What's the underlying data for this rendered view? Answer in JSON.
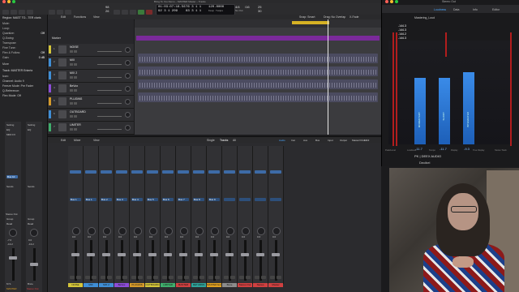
{
  "window": {
    "title": "Bring To You Demo – MASTER Master – Tracks"
  },
  "transport": {
    "position_time": "01:03:07:18.56",
    "position_bars": "92  3  1  209",
    "bars_alt": "76  3  1  1",
    "bars_alt2": "83  3  1  1",
    "tempo": "120.0000",
    "keep_tempo": "Keep Tempo",
    "sig": "4/4",
    "no_out": "No Out",
    "div": "/16",
    "extra_a": "98",
    "extra_b": "26",
    "extra_c": "25",
    "extra_d": "30"
  },
  "local_menu": {
    "edit": "Edit",
    "functions": "Functions",
    "view": "View",
    "snap": "Snap: Smart",
    "drag": "Drag: No Overlap",
    "fade": "X-Fade"
  },
  "inspector": {
    "region_label": "Region: MAST TO...TER claris",
    "rows": [
      {
        "label": "Mute:",
        "value": ""
      },
      {
        "label": "Loop:",
        "value": ""
      },
      {
        "label": "Quantize:",
        "value": "Off"
      },
      {
        "label": "Q-Swing:",
        "value": ""
      },
      {
        "label": "Transpose:",
        "value": ""
      },
      {
        "label": "Fine Tune:",
        "value": ""
      },
      {
        "label": "Flex & Follow:",
        "value": "Off"
      },
      {
        "label": "Gain:",
        "value": "0 dB"
      }
    ],
    "more_label": "More",
    "track_label": "Track: MASTER Entertz",
    "icon_label": "Icon:",
    "channel_label": "Channel: Audio 9",
    "freeze_label": "Freeze Mode: Pre Fader",
    "q_reference": "Q-Reference:",
    "flex_mode": "Flex Mode: Off",
    "setting": "Setting",
    "eq": "EQ",
    "midi_fx": "MIDI FX",
    "sends": "Sends",
    "bus_label": "Bus 10",
    "stereo_out": "Stereo Out",
    "group": "Group",
    "read": "Read",
    "left_vol": "-7.0",
    "right_vol": "0.0",
    "left_pan": "-13.2",
    "right_pan": "-13.2",
    "bnc": "Bnce",
    "mute_solo": "M  S",
    "left_name": "MASTER",
    "right_name": "Stereo Out"
  },
  "mixer_tab": {
    "mixer": "Mixer",
    "single": "Single",
    "tracks": "Tracks",
    "all": "All"
  },
  "mixer_filters": [
    "Audio",
    "Inst",
    "Aux",
    "Bus",
    "Input",
    "Output",
    "Master/VCA",
    "MIDI"
  ],
  "tracks": [
    {
      "name": "NOISE",
      "num": "1"
    },
    {
      "name": "MIX",
      "num": "2"
    },
    {
      "name": "MIX 2",
      "num": "3"
    },
    {
      "name": "BeVox",
      "num": "4"
    },
    {
      "name": "PLUGINS",
      "num": "5"
    },
    {
      "name": "OUTBOARD",
      "num": "6"
    },
    {
      "name": "LIMITER",
      "num": "7"
    }
  ],
  "marker": {
    "label": "Marker"
  },
  "strips": [
    {
      "name": "NOISE",
      "color": "#d4c53a",
      "vol": "0.0",
      "plugin": "Stereo Out",
      "bus": "Bus 1"
    },
    {
      "name": "MIX",
      "color": "#3f8ed6",
      "vol": "0.0",
      "plugin": "",
      "bus": "Bus 1"
    },
    {
      "name": "MIX 2",
      "color": "#3f8ed6",
      "vol": "0.0",
      "plugin": "",
      "bus": "Bus 2"
    },
    {
      "name": "BeVox",
      "color": "#8c4dd8",
      "vol": "0.0",
      "plugin": "",
      "bus": "Bus 3"
    },
    {
      "name": "PLUGINS",
      "color": "#d59a2a",
      "vol": "0.0",
      "plugin": "",
      "bus": "Bus 4"
    },
    {
      "name": "OUTBOARD",
      "color": "#d4c53a",
      "vol": "0.0",
      "plugin": "",
      "bus": "Bus 5"
    },
    {
      "name": "LIMITER",
      "color": "#3fae6c",
      "vol": "0.0",
      "plugin": "",
      "bus": "Bus 6"
    },
    {
      "name": "MASTER",
      "color": "#d04040",
      "vol": "0.0",
      "plugin": "",
      "bus": "Bus 7"
    },
    {
      "name": "RETURNS",
      "color": "#2fa39a",
      "vol": "0.0",
      "plugin": "",
      "bus": "Bus 8"
    },
    {
      "name": "MASTER Ent",
      "color": "#e0a020",
      "vol": "0.0",
      "plugin": "",
      "bus": "Bus 9"
    },
    {
      "name": "Bnce",
      "color": "#8c8c8c",
      "vol": "0.0",
      "plugin": "",
      "bus": ""
    },
    {
      "name": "Stereo Out",
      "color": "#d04040",
      "vol": "0.0",
      "plugin": "",
      "bus": ""
    },
    {
      "name": "Stereo",
      "color": "#d04040",
      "vol": "0.0",
      "plugin": "",
      "bus": ""
    },
    {
      "name": "Master",
      "color": "#d04040",
      "vol": "0.0",
      "plugin": "",
      "bus": ""
    }
  ],
  "plugin": {
    "title": "Stereo Out",
    "preset": "Mastering_Loud",
    "tabs": [
      "Loudness",
      "Data",
      "Info",
      "Editor"
    ],
    "readouts": [
      "-144.3",
      "-144.3",
      "-144.2",
      "-144.3"
    ],
    "bars": [
      {
        "label": "MOMENTARY",
        "value": "-11.7",
        "level": 0.68
      },
      {
        "label": "SHORT",
        "value": "-11.7",
        "level": 0.68
      },
      {
        "label": "INTEGRATED",
        "value": "-9.3",
        "level": 0.74
      }
    ],
    "brand": "PK | DEEX AUDIO",
    "unit": "Decibel",
    "bottom_labels": [
      "Peak/Level",
      "Loudness",
      "Tempo",
      "Display",
      "True Display",
      "Stereo Track"
    ]
  }
}
